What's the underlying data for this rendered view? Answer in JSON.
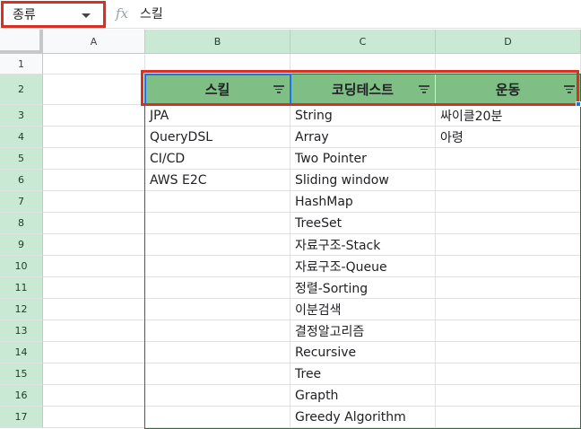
{
  "formula_bar": {
    "name_box": "종류",
    "fx": "fx",
    "content": "스킬"
  },
  "columns": [
    "A",
    "B",
    "C",
    "D"
  ],
  "rows": [
    "1",
    "2",
    "3",
    "4",
    "5",
    "6",
    "7",
    "8",
    "9",
    "10",
    "11",
    "12",
    "13",
    "14",
    "15",
    "16",
    "17"
  ],
  "headers": {
    "B": "스킬",
    "C": "코딩테스트",
    "D": "운동"
  },
  "cells": {
    "B": [
      "JPA",
      "QueryDSL",
      "CI/CD",
      "AWS E2C"
    ],
    "C": [
      "String",
      "Array",
      "Two Pointer",
      "Sliding window",
      "HashMap",
      "TreeSet",
      "자료구조-Stack",
      "자료구조-Queue",
      "정렬-Sorting",
      "이분검색",
      "결정알고리즘",
      "Recursive",
      "Tree",
      "Grapth",
      "Greedy Algorithm"
    ],
    "D": [
      "싸이클20분",
      "아령"
    ]
  },
  "colors": {
    "header_fill": "#7fbf86",
    "selection_border": "#1a7a43",
    "focus_border": "#1a73e8",
    "annotation_red": "#d93025"
  }
}
